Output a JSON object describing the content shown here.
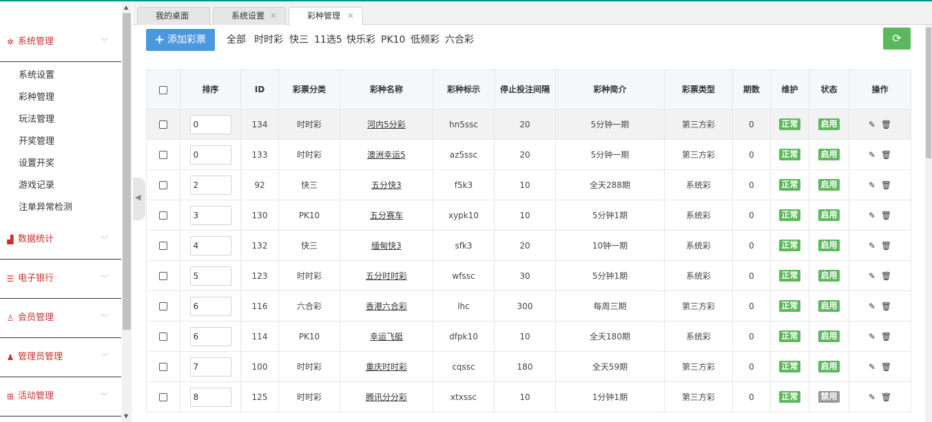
{
  "sidebar": {
    "groups": [
      {
        "label": "系统管理",
        "icon": "gear-icon",
        "glyph": "✲"
      },
      {
        "label": "数据统计",
        "icon": "bar-chart-icon",
        "glyph": "▟"
      },
      {
        "label": "电子银行",
        "icon": "list-icon",
        "glyph": "☰"
      },
      {
        "label": "会员管理",
        "icon": "user-outline-icon",
        "glyph": "♙"
      },
      {
        "label": "管理员管理",
        "icon": "user-solid-icon",
        "glyph": "♟"
      },
      {
        "label": "活动管理",
        "icon": "gift-icon",
        "glyph": "⊞"
      }
    ],
    "sub_items": [
      "系统设置",
      "彩种管理",
      "玩法管理",
      "开奖管理",
      "设置开奖",
      "游戏记录",
      "注单异常检测"
    ]
  },
  "tabs": [
    {
      "label": "我的桌面",
      "closable": false
    },
    {
      "label": "系统设置",
      "closable": true
    },
    {
      "label": "彩种管理",
      "closable": true
    }
  ],
  "toolbar": {
    "add_label": "添加彩票",
    "filters": [
      "全部",
      "时时彩",
      "快三",
      "11选5",
      "快乐彩",
      "PK10",
      "低频彩",
      "六合彩"
    ]
  },
  "table": {
    "headers": [
      "排序",
      "ID",
      "彩票分类",
      "彩种名称",
      "彩种标示",
      "停止投注间隔",
      "彩种简介",
      "彩票类型",
      "期数",
      "维护",
      "状态",
      "操作"
    ],
    "rows": [
      {
        "sort": "0",
        "id": "134",
        "category": "时时彩",
        "name": "河内5分彩",
        "code": "hn5ssc",
        "interval": "20",
        "intro": "5分钟一期",
        "type": "第三方彩",
        "periods": "0",
        "maint": "正常",
        "status": "启用"
      },
      {
        "sort": "0",
        "id": "133",
        "category": "时时彩",
        "name": "澳洲幸运5",
        "code": "az5ssc",
        "interval": "20",
        "intro": "5分钟一期",
        "type": "第三方彩",
        "periods": "0",
        "maint": "正常",
        "status": "启用"
      },
      {
        "sort": "2",
        "id": "92",
        "category": "快三",
        "name": "五分快3",
        "code": "f5k3",
        "interval": "10",
        "intro": "全天288期",
        "type": "系统彩",
        "periods": "0",
        "maint": "正常",
        "status": "启用"
      },
      {
        "sort": "3",
        "id": "130",
        "category": "PK10",
        "name": "五分赛车",
        "code": "xypk10",
        "interval": "10",
        "intro": "5分钟1期",
        "type": "系统彩",
        "periods": "0",
        "maint": "正常",
        "status": "启用"
      },
      {
        "sort": "4",
        "id": "132",
        "category": "快三",
        "name": "缅甸快3",
        "code": "sfk3",
        "interval": "20",
        "intro": "10钟一期",
        "type": "系统彩",
        "periods": "0",
        "maint": "正常",
        "status": "启用"
      },
      {
        "sort": "5",
        "id": "123",
        "category": "时时彩",
        "name": "五分时时彩",
        "code": "wfssc",
        "interval": "30",
        "intro": "5分钟1期",
        "type": "系统彩",
        "periods": "0",
        "maint": "正常",
        "status": "启用"
      },
      {
        "sort": "6",
        "id": "116",
        "category": "六合彩",
        "name": "香港六合彩",
        "code": "lhc",
        "interval": "300",
        "intro": "每周三期",
        "type": "第三方彩",
        "periods": "0",
        "maint": "正常",
        "status": "启用"
      },
      {
        "sort": "6",
        "id": "114",
        "category": "PK10",
        "name": "幸运飞艇",
        "code": "dfpk10",
        "interval": "10",
        "intro": "全天180期",
        "type": "系统彩",
        "periods": "0",
        "maint": "正常",
        "status": "启用"
      },
      {
        "sort": "7",
        "id": "100",
        "category": "时时彩",
        "name": "重庆时时彩",
        "code": "cqssc",
        "interval": "180",
        "intro": "全天59期",
        "type": "第三方彩",
        "periods": "0",
        "maint": "正常",
        "status": "启用"
      },
      {
        "sort": "8",
        "id": "125",
        "category": "时时彩",
        "name": "腾讯分分彩",
        "code": "xtxssc",
        "interval": "10",
        "intro": "1分钟1期",
        "type": "第三方彩",
        "periods": "0",
        "maint": "正常",
        "status": "禁用"
      }
    ]
  },
  "icons": {
    "add": "plus-icon",
    "refresh": "refresh-icon",
    "edit": "pencil-icon",
    "delete": "trash-icon",
    "close": "close-icon",
    "chevron": "chevron-down-icon"
  },
  "colors": {
    "accent_red": "#c9302c",
    "primary_blue": "#4b98e0",
    "success_green": "#5cb85c",
    "disabled_gray": "#999999"
  }
}
